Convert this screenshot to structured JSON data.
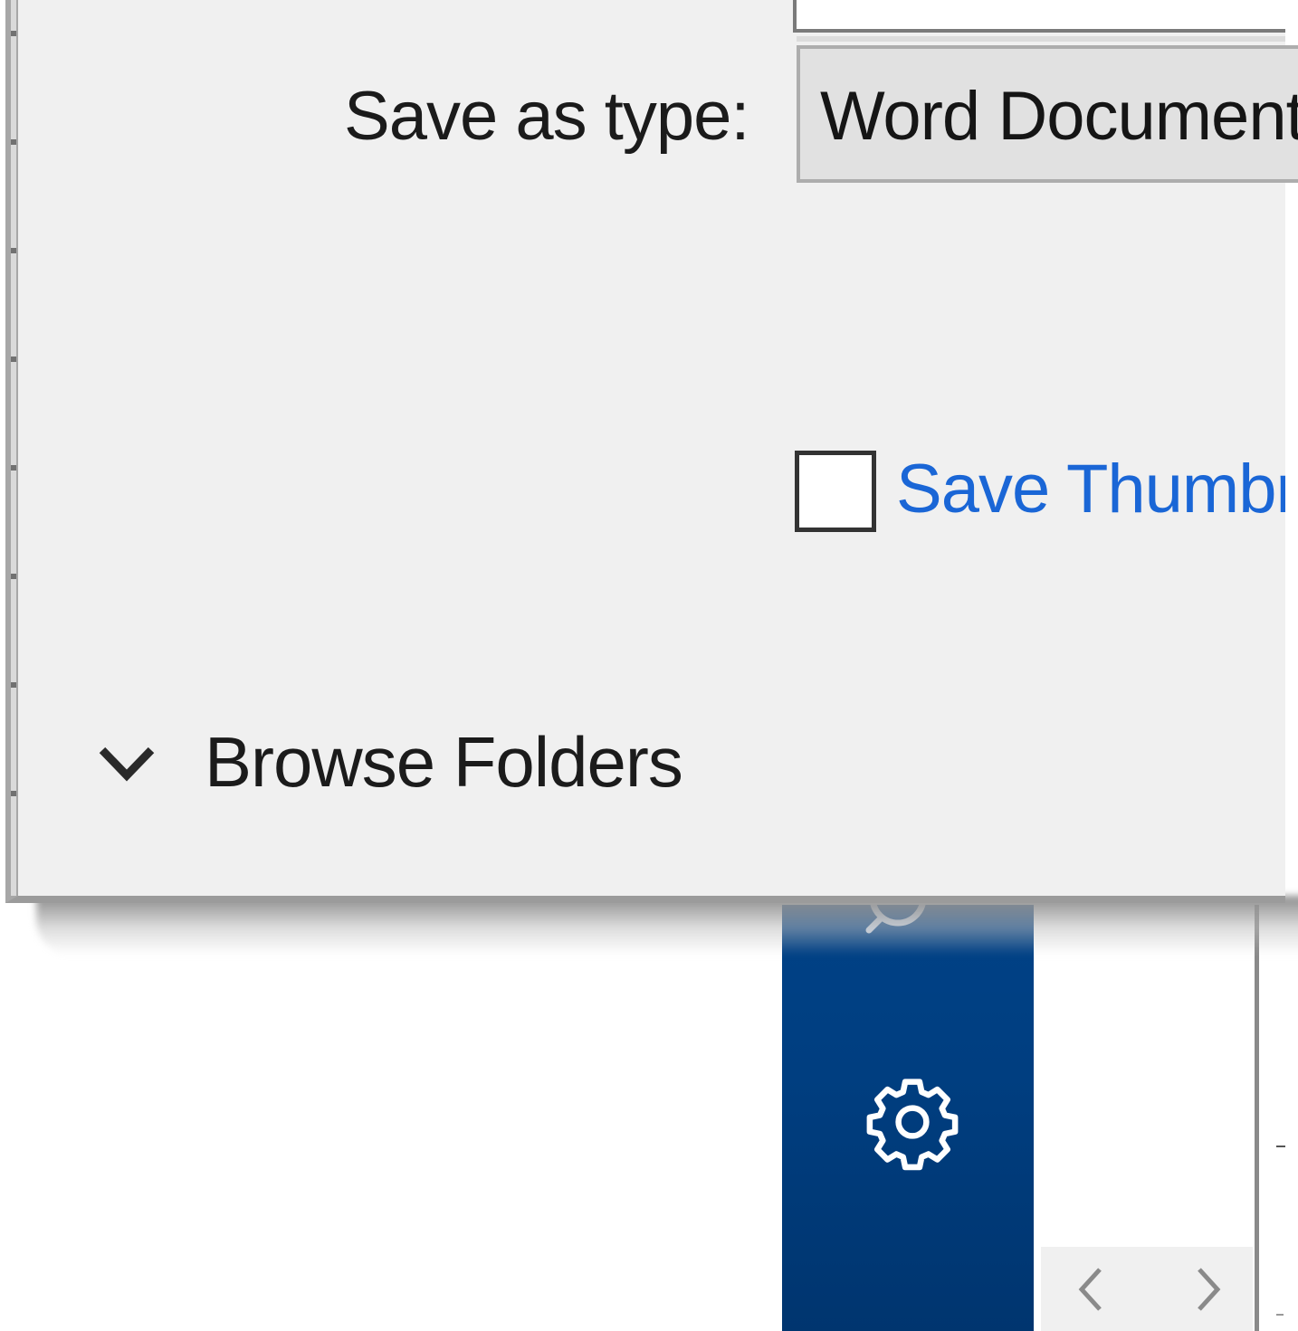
{
  "dialog": {
    "save_as_type_label": "Save as type:",
    "save_as_type_value": "Word Document",
    "save_thumbnail_label": "Save Thumbnail",
    "save_thumbnail_checked": false,
    "browse_folders_label": "Browse Folders"
  },
  "background_app": {
    "nav_icons": [
      "search-icon",
      "settings-icon"
    ],
    "scroll_buttons": [
      "chevron-left-icon",
      "chevron-right-icon"
    ]
  },
  "colors": {
    "dialog_bg": "#f0f0f0",
    "link_blue": "#1a66d6",
    "nav_blue": "#003e80"
  }
}
